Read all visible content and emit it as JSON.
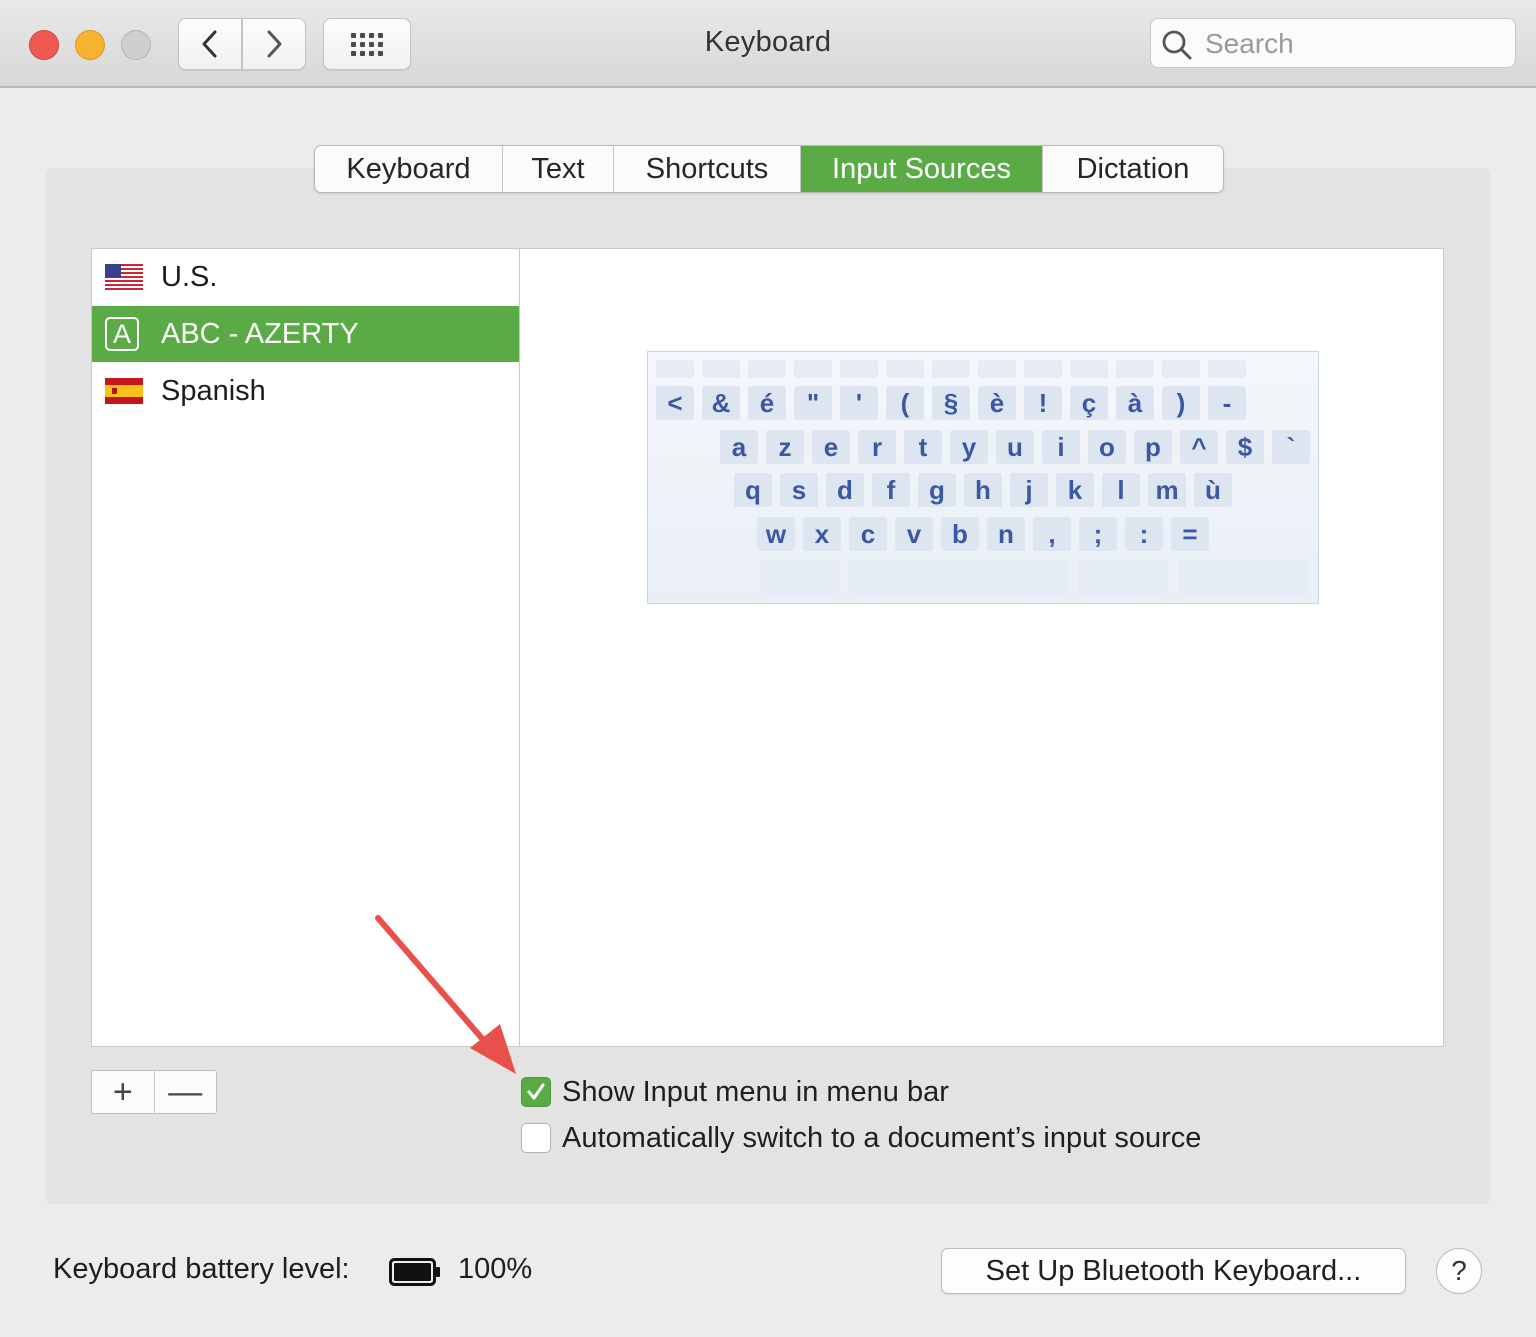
{
  "window": {
    "title": "Keyboard"
  },
  "toolbar": {
    "back_icon": "chevron-left-icon",
    "forward_icon": "chevron-right-icon",
    "grid_icon": "grid-icon",
    "search_placeholder": "Search"
  },
  "tabs": [
    {
      "label": "Keyboard",
      "active": false
    },
    {
      "label": "Text",
      "active": false
    },
    {
      "label": "Shortcuts",
      "active": false
    },
    {
      "label": "Input Sources",
      "active": true
    },
    {
      "label": "Dictation",
      "active": false
    }
  ],
  "input_sources": [
    {
      "label": "U.S.",
      "icon": "us-flag-icon",
      "selected": false
    },
    {
      "label": "ABC - AZERTY",
      "icon": "letter-a-icon",
      "icon_text": "A",
      "selected": true
    },
    {
      "label": "Spanish",
      "icon": "spain-flag-icon",
      "selected": false
    }
  ],
  "keyboard_preview": {
    "row1": [
      "<",
      "&",
      "é",
      "\"",
      "'",
      "(",
      "§",
      "è",
      "!",
      "ç",
      "à",
      ")",
      "-"
    ],
    "row2": [
      "a",
      "z",
      "e",
      "r",
      "t",
      "y",
      "u",
      "i",
      "o",
      "p",
      "^",
      "$",
      "`"
    ],
    "row3": [
      "q",
      "s",
      "d",
      "f",
      "g",
      "h",
      "j",
      "k",
      "l",
      "m",
      "ù"
    ],
    "row4": [
      "w",
      "x",
      "c",
      "v",
      "b",
      "n",
      ",",
      ";",
      ":",
      "="
    ]
  },
  "list_controls": {
    "add": "+",
    "remove": "—"
  },
  "options": {
    "show_input_menu": {
      "label": "Show Input menu in menu bar",
      "checked": true
    },
    "auto_switch": {
      "label": "Automatically switch to a document’s input source",
      "checked": false
    }
  },
  "footer": {
    "battery_label": "Keyboard battery level:",
    "battery_value": "100%",
    "battery_level": 1.0,
    "bluetooth_button": "Set Up Bluetooth Keyboard...",
    "help_button": "?"
  },
  "colors": {
    "accent": "#5aab45",
    "key_text": "#3d58a2",
    "annotation_arrow": "#e8504a"
  }
}
